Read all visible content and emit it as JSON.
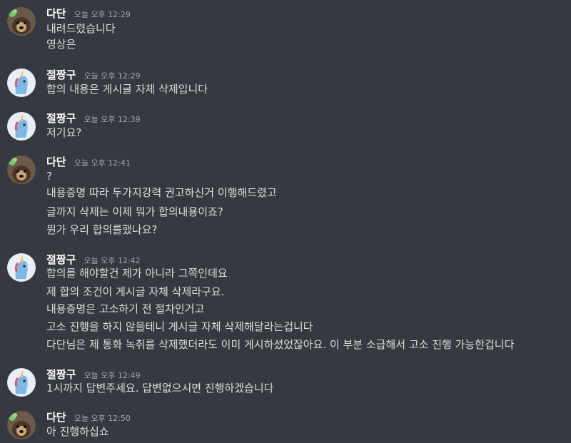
{
  "messages": [
    {
      "user": "다단",
      "avatar": "dog-avatar",
      "time": "오늘 오후 12:29",
      "lines": [
        "내려드렸습니다",
        "영상은"
      ]
    },
    {
      "user": "절짱구",
      "avatar": "unicorn-avatar",
      "time": "오늘 오후 12:29",
      "lines": [
        "합의 내용은 게시글 자체 삭제입니다"
      ]
    },
    {
      "user": "절짱구",
      "avatar": "unicorn-avatar",
      "time": "오늘 오후 12:39",
      "lines": [
        "저기요?"
      ]
    },
    {
      "user": "다단",
      "avatar": "dog-avatar",
      "time": "오늘 오후 12:41",
      "lines": [
        "?",
        "내용증명 따라 두가지강력 권고하신거 이행해드렸고",
        "글까지 삭제는 이제 뭐가 합의내용이죠?",
        "뭔가 우리 합의를했나요?"
      ]
    },
    {
      "user": "절짱구",
      "avatar": "unicorn-avatar",
      "time": "오늘 오후 12:42",
      "lines": [
        "합의를 해야할건 제가 아니라 그쪽인데요",
        "제 합의 조건이 게시글 자체 삭제라구요.",
        "내용증명은 고소하기 전 절차인거고",
        "고소 진행을 하지 않을테니 게시글 자체 삭제해달라는겁니다",
        "다단님은 제 통화 녹취를 삭제했더라도 이미 게시하셨었잖아요. 이 부분 소급해서 고소 진행 가능한겁니다"
      ]
    },
    {
      "user": "절짱구",
      "avatar": "unicorn-avatar",
      "time": "오늘 오후 12:49",
      "lines": [
        "1시까지 답변주세요. 답변없으시면 진행하겠습니다"
      ]
    },
    {
      "user": "다단",
      "avatar": "dog-avatar",
      "time": "오늘 오후 12:50",
      "lines": [
        "아 진행하십쇼"
      ]
    }
  ],
  "colors": {
    "background": "#36393f",
    "username": "#ffffff",
    "text": "#dcddde",
    "timestamp": "#a3a6aa"
  }
}
